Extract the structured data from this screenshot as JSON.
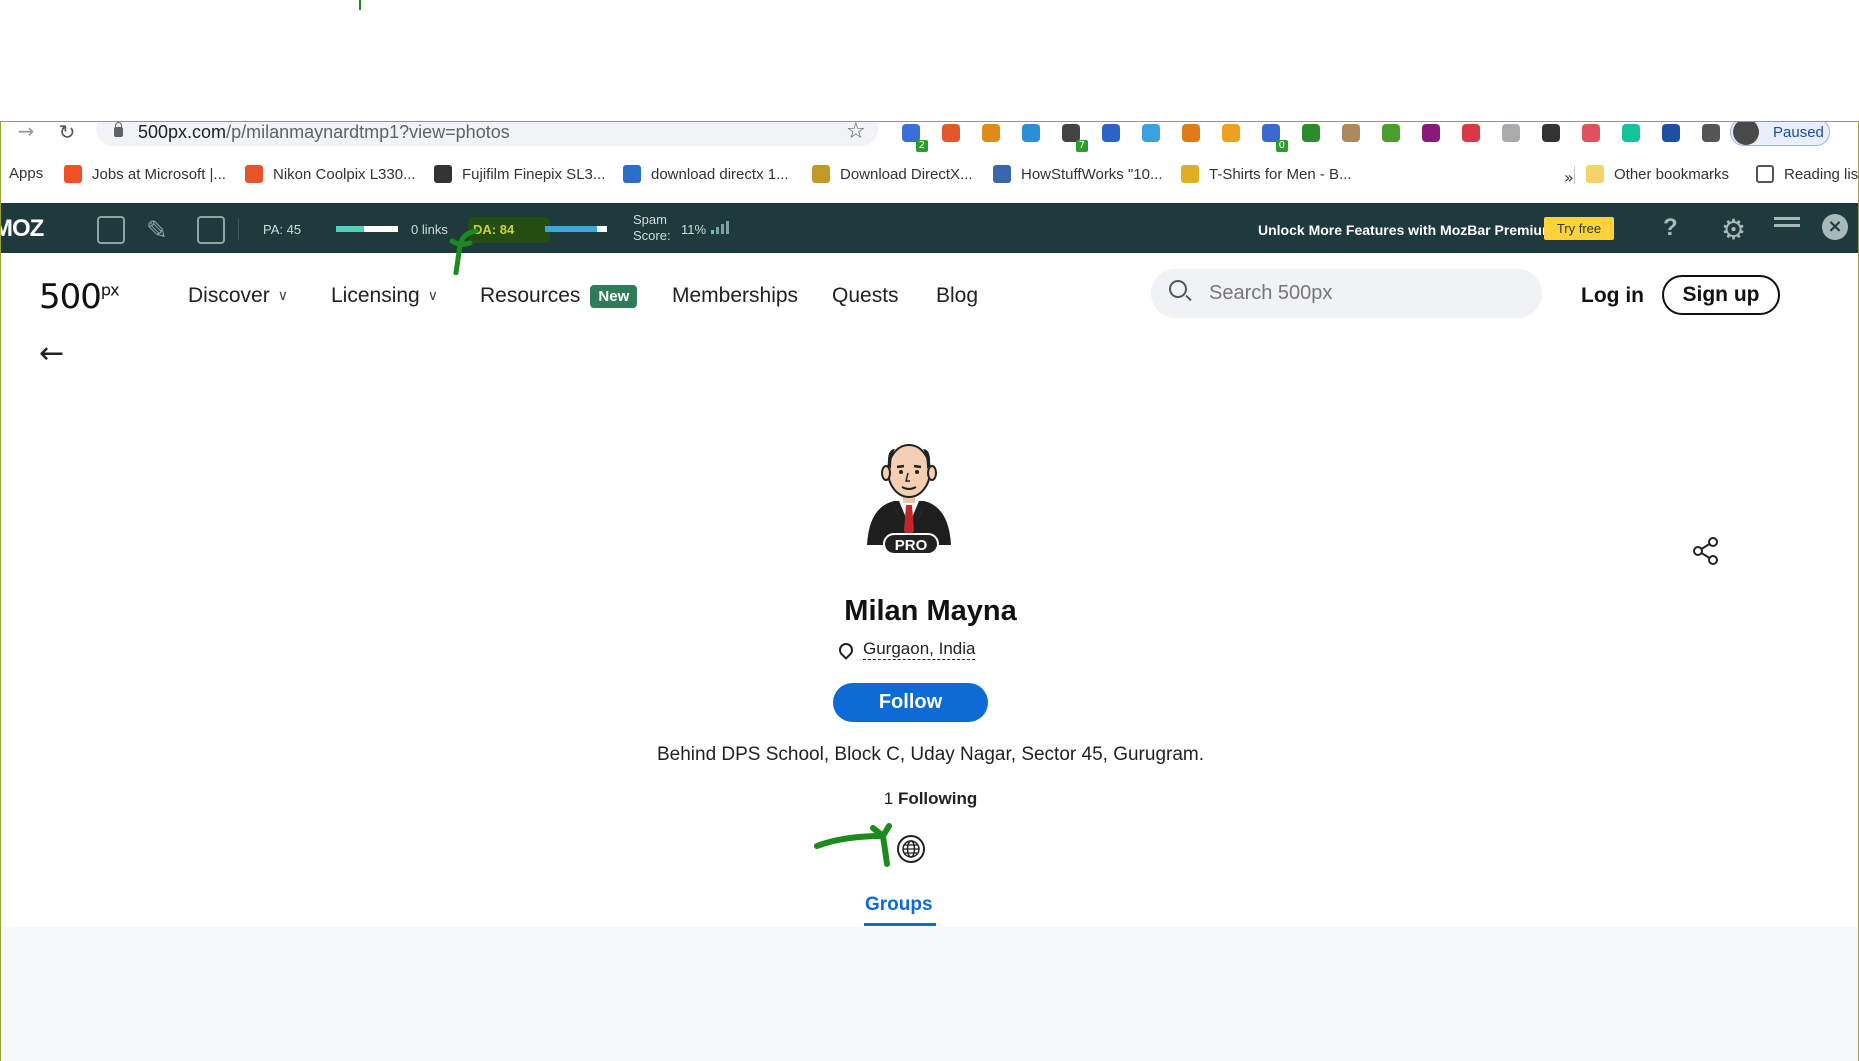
{
  "browser": {
    "url_host": "500px.com",
    "url_path": "/p/milanmaynardtmp1?view=photos",
    "profile_status": "Paused",
    "extensions": [
      {
        "name": "ext-code-icon",
        "color": "#3b6fd8",
        "badge": "2"
      },
      {
        "name": "ext-fox-icon",
        "color": "#e2572b"
      },
      {
        "name": "ext-seo-icon",
        "color": "#e08a1e"
      },
      {
        "name": "ext-m-icon",
        "color": "#2c8fd6"
      },
      {
        "name": "ext-search-icon",
        "color": "#444",
        "badge": "7"
      },
      {
        "name": "ext-swirl-icon",
        "color": "#2b63c7"
      },
      {
        "name": "ext-bird-icon",
        "color": "#3aa0e0"
      },
      {
        "name": "ext-bot-icon",
        "color": "#e07b19"
      },
      {
        "name": "ext-key-icon",
        "color": "#f0a020"
      },
      {
        "name": "ext-link-icon",
        "color": "#3a6ad0",
        "badge": "0"
      },
      {
        "name": "ext-bw-icon",
        "color": "#2b8a2b"
      },
      {
        "name": "ext-w-icon",
        "color": "#b08860"
      },
      {
        "name": "ext-leaf-icon",
        "color": "#4a9e2e"
      },
      {
        "name": "ext-grid-icon",
        "color": "#8a1a7a"
      },
      {
        "name": "ext-pocket-icon",
        "color": "#d8384a"
      },
      {
        "name": "ext-k-icon",
        "color": "#aaaaaa"
      },
      {
        "name": "ext-pen-icon",
        "color": "#333333"
      },
      {
        "name": "ext-upload-icon",
        "color": "#e05060"
      },
      {
        "name": "ext-grammarly-icon",
        "color": "#15c39a"
      },
      {
        "name": "ext-check-icon",
        "color": "#1d4fa3"
      },
      {
        "name": "puzzle-icon",
        "color": "#555555"
      }
    ]
  },
  "bookmarks": [
    {
      "label": "Apps",
      "color": "#4a86e8"
    },
    {
      "label": "Jobs at Microsoft |...",
      "color": "#f25022"
    },
    {
      "label": "Nikon Coolpix L330...",
      "color": "#e8542a"
    },
    {
      "label": "Fujifilm Finepix SL3...",
      "color": "#333333"
    },
    {
      "label": "download directx 1...",
      "color": "#2a70c7"
    },
    {
      "label": "Download DirectX...",
      "color": "#c29a2a"
    },
    {
      "label": "HowStuffWorks \"10...",
      "color": "#3a66b0"
    },
    {
      "label": "T-Shirts for Men - B...",
      "color": "#e0b020"
    }
  ],
  "bookmarks_more": "»",
  "other_bookmarks": "Other bookmarks",
  "reading_list": "Reading lis",
  "mozbar": {
    "logo": "MOZ",
    "pa_label": "PA: 45",
    "pa_fill": 0.45,
    "links": "0 links",
    "da_label": "DA: 84",
    "da_fill": 0.84,
    "spam_label_1": "Spam",
    "spam_label_2": "Score:",
    "spam_value": "11%",
    "unlock": "Unlock More Features with MozBar Premium",
    "try_free": "Try free",
    "help": "?",
    "colors": {
      "bg": "#1f3a3d",
      "pa": "#4fd1b7",
      "da": "#3aa8e0",
      "try": "#ffd23b"
    }
  },
  "site": {
    "logo": "500",
    "logo_sup": "px",
    "nav": [
      {
        "label": "Discover",
        "chevron": true
      },
      {
        "label": "Licensing",
        "chevron": true
      },
      {
        "label": "Resources",
        "badge": "New"
      },
      {
        "label": "Memberships"
      },
      {
        "label": "Quests"
      },
      {
        "label": "Blog"
      }
    ],
    "search_placeholder": "Search 500px",
    "login": "Log in",
    "signup": "Sign up"
  },
  "profile": {
    "badge": "PRO",
    "name": "Milan Mayna",
    "location": "Gurgaon, India",
    "follow": "Follow",
    "bio": "Behind DPS School, Block C, Uday Nagar, Sector 45, Gurugram.",
    "following_count": "1",
    "following_label": "Following",
    "tab": "Groups",
    "accent": "#0e6ad4"
  }
}
